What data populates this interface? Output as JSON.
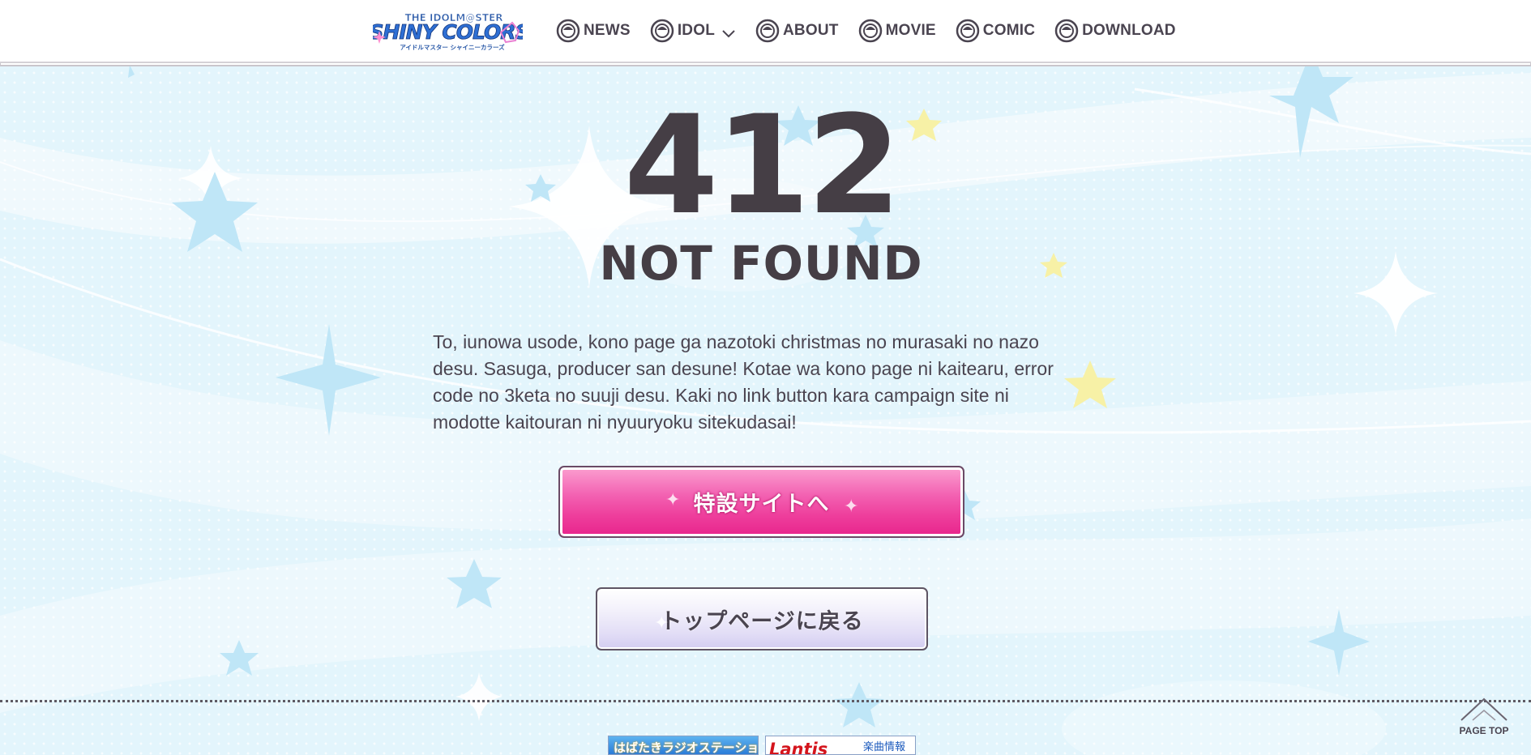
{
  "header": {
    "logo": {
      "line1": "THE IDOLM@STER",
      "line2": "SHINY COLORS",
      "line3": "アイドルマスター シャイニーカラーズ"
    },
    "nav": [
      {
        "label": "NEWS",
        "icon": "idol-face-icon"
      },
      {
        "label": "IDOL",
        "icon": "idol-face-icon",
        "dropdown": true
      },
      {
        "label": "ABOUT",
        "icon": "idol-face-icon"
      },
      {
        "label": "MOVIE",
        "icon": "idol-face-icon"
      },
      {
        "label": "COMIC",
        "icon": "idol-face-icon"
      },
      {
        "label": "DOWNLOAD",
        "icon": "idol-face-icon"
      }
    ]
  },
  "error": {
    "code": "412",
    "title": "NOT FOUND",
    "message": "To, iunowa usode, kono page ga nazotoki christmas no murasaki no nazo desu. Sasuga, producer san desune! Kotae wa kono page ni kaitearu, error code no 3keta no suuji desu. Kaki no link button kara campaign site ni modotte kaitouran ni nyuuryoku sitekudasai!"
  },
  "buttons": {
    "special_site": "特設サイトへ",
    "back_to_top": "トップページに戻る"
  },
  "footer": {
    "page_top": "PAGE TOP",
    "banners": [
      {
        "text": "はばたきラジオステーション"
      },
      {
        "brand": "Lantis",
        "tag": "楽曲情報"
      }
    ]
  },
  "colors": {
    "background": "#e3f5fc",
    "accent_pink": "#ee3e9c",
    "text": "#453e45",
    "star_blue": "#bfe6f7",
    "star_yellow": "#f7f1a6"
  }
}
